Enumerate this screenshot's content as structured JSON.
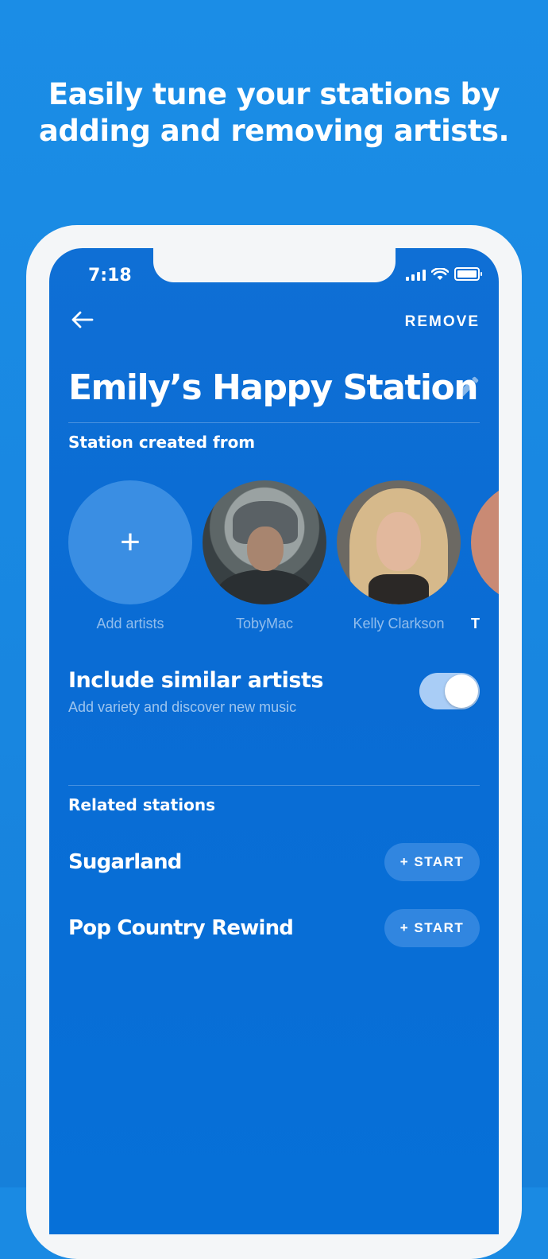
{
  "headline": {
    "line1": "Easily tune your stations by",
    "line2": "adding and removing artists."
  },
  "status_bar": {
    "time": "7:18",
    "icons": [
      "signal-icon",
      "wifi-icon",
      "battery-icon"
    ]
  },
  "nav": {
    "back_icon": "arrow-left-icon",
    "remove_label": "REMOVE"
  },
  "station": {
    "title": "Emily’s Happy Station",
    "edit_icon": "pencil-icon",
    "created_from_label": "Station created from"
  },
  "artists": [
    {
      "name": "Add artists",
      "icon": "plus-icon"
    },
    {
      "name": "TobyMac"
    },
    {
      "name": "Kelly Clarkson"
    },
    {
      "name": "T"
    }
  ],
  "similar": {
    "title": "Include similar artists",
    "subtitle": "Add variety and discover new music",
    "enabled": true
  },
  "related": {
    "label": "Related stations",
    "items": [
      {
        "name": "Sugarland",
        "button": "+ START"
      },
      {
        "name": "Pop Country Rewind",
        "button": "+ START"
      }
    ]
  },
  "colors": {
    "background": "#1a8ae3",
    "screen": "#0a6cd4",
    "button": "#3186e0",
    "toggle_track": "#a9cdf6"
  }
}
